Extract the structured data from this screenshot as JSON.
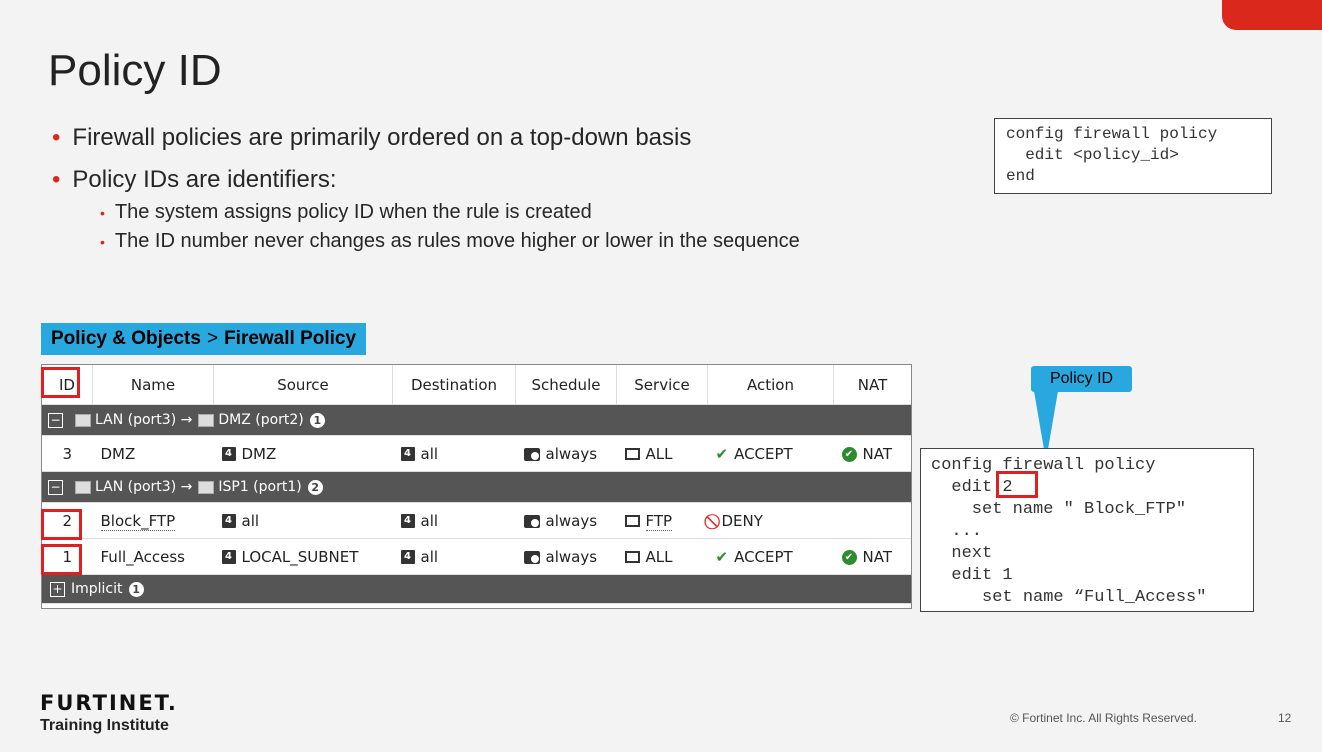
{
  "slide": {
    "title": "Policy ID",
    "bullets": [
      {
        "level": 1,
        "text": "Firewall policies are primarily ordered on a top-down basis"
      },
      {
        "level": 1,
        "text": "Policy IDs are identifiers:"
      },
      {
        "level": 2,
        "text": "The system assigns policy ID when the rule is created"
      },
      {
        "level": 2,
        "text": "The ID number never changes as rules move higher or lower in the sequence"
      }
    ],
    "code_top": "config firewall policy\n  edit <policy_id>\nend",
    "breadcrumb": {
      "section": "Policy & Objects",
      "separator": ">",
      "page": "Firewall Policy"
    },
    "table": {
      "headers": [
        "ID",
        "Name",
        "Source",
        "Destination",
        "Schedule",
        "Service",
        "Action",
        "NAT"
      ],
      "groups": [
        {
          "from": "LAN (port3)",
          "arrow": "→",
          "to": "DMZ (port2)",
          "count": "1",
          "rows": [
            {
              "id": "3",
              "name": "DMZ",
              "source": "DMZ",
              "destination": "all",
              "schedule": "always",
              "service": "ALL",
              "action": "ACCEPT",
              "nat": "NAT"
            }
          ]
        },
        {
          "from": "LAN (port3)",
          "arrow": "→",
          "to": "ISP1 (port1)",
          "count": "2",
          "rows": [
            {
              "id": "2",
              "name": "Block_FTP",
              "source": "all",
              "destination": "all",
              "schedule": "always",
              "service": "FTP",
              "action": "DENY",
              "nat": ""
            },
            {
              "id": "1",
              "name": "Full_Access",
              "source": "LOCAL_SUBNET",
              "destination": "all",
              "schedule": "always",
              "service": "ALL",
              "action": "ACCEPT",
              "nat": "NAT"
            }
          ]
        }
      ],
      "implicit": {
        "label": "Implicit",
        "count": "1"
      }
    },
    "callout": "Policy ID",
    "code_bottom": "config firewall policy\n  edit 2\n    set name \" Block_FTP\"\n  ...\n  next\n  edit 1\n     set name “Full_Access\"",
    "footer": {
      "logo_text": "FURTINET.",
      "logo_sub": "Training Institute",
      "copyright": "© Fortinet Inc. All Rights Reserved.",
      "page_number": "12"
    },
    "colors": {
      "accent_red": "#da291c",
      "callout_blue": "#29a8e0",
      "group_row": "#555555"
    }
  }
}
